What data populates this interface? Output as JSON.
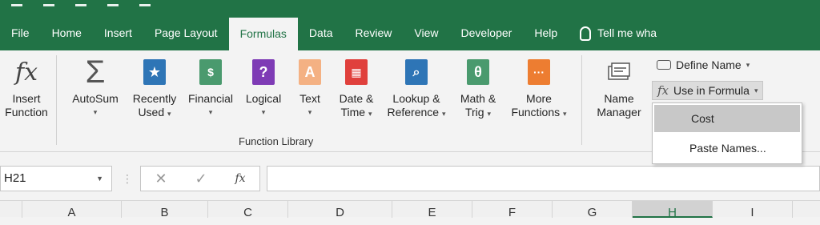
{
  "tabs": [
    {
      "label": "File"
    },
    {
      "label": "Home"
    },
    {
      "label": "Insert"
    },
    {
      "label": "Page Layout"
    },
    {
      "label": "Formulas"
    },
    {
      "label": "Data"
    },
    {
      "label": "Review"
    },
    {
      "label": "View"
    },
    {
      "label": "Developer"
    },
    {
      "label": "Help"
    },
    {
      "label": "Tell me wha"
    }
  ],
  "ribbon": {
    "insert_function": {
      "line1": "Insert",
      "line2": "Function",
      "icon": "fx"
    },
    "autosum": {
      "line1": "AutoSum",
      "icon": "Σ"
    },
    "recently_used": {
      "line1": "Recently",
      "line2": "Used",
      "icon": "★"
    },
    "financial": {
      "line1": "Financial"
    },
    "logical": {
      "line1": "Logical",
      "icon": "?"
    },
    "text": {
      "line1": "Text",
      "icon": "A"
    },
    "date_time": {
      "line1": "Date &",
      "line2": "Time"
    },
    "lookup_reference": {
      "line1": "Lookup &",
      "line2": "Reference"
    },
    "math_trig": {
      "line1": "Math &",
      "line2": "Trig",
      "icon": "θ"
    },
    "more_functions": {
      "line1": "More",
      "line2": "Functions",
      "icon": "···"
    },
    "function_library_label": "Function Library",
    "name_manager": {
      "line1": "Name",
      "line2": "Manager"
    },
    "define_name": "Define Name",
    "use_in_formula": "Use in Formula"
  },
  "menu": {
    "items": [
      {
        "label": "Cost"
      },
      {
        "label": "Paste Names..."
      }
    ]
  },
  "formula_bar": {
    "name_box": "H21",
    "fx": "fx",
    "formula": ""
  },
  "columns": [
    "A",
    "B",
    "C",
    "D",
    "E",
    "F",
    "G",
    "H",
    "I"
  ],
  "selected_column": "H",
  "colors": {
    "accent": "#217346",
    "financial": "#4a9a6e",
    "logical": "#7e3bb5",
    "text": "#f4b183",
    "date": "#e0403c",
    "lookup": "#2e75b6",
    "math": "#4a9a6e",
    "more": "#ed7d31"
  }
}
